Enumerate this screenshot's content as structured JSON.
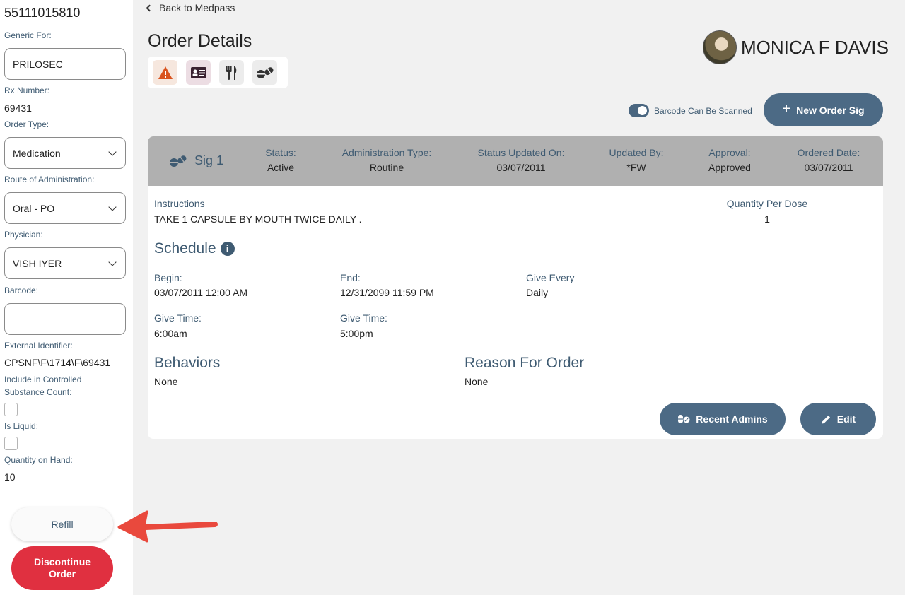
{
  "sidebar": {
    "ndc": "55111015810",
    "generic_label": "Generic For:",
    "generic_value": "PRILOSEC",
    "rx_label": "Rx Number:",
    "rx_value": "69431",
    "order_type_label": "Order Type:",
    "order_type_value": "Medication",
    "route_label": "Route of Administration:",
    "route_value": "Oral - PO",
    "physician_label": "Physician:",
    "physician_value": "VISH IYER",
    "barcode_label": "Barcode:",
    "barcode_value": "",
    "external_label": "External Identifier:",
    "external_value": "CPSNF\\F\\1714\\F\\69431",
    "controlled_label_1": "Include in Controlled",
    "controlled_label_2": "Substance Count:",
    "liquid_label": "Is Liquid:",
    "qoh_label": "Quantity on Hand:",
    "qoh_value": "10",
    "refill_label": "Refill",
    "discontinue_label": "Discontinue Order"
  },
  "header": {
    "back_label": "Back to Medpass",
    "title": "Order Details",
    "patient_name": "MONICA F DAVIS",
    "barcode_toggle_label": "Barcode Can Be Scanned",
    "new_order_sig_label": "New Order Sig"
  },
  "icons": {
    "alert": "warning-icon",
    "id": "id-card-icon",
    "diet": "fork-knife-icon",
    "meds": "pills-icon",
    "alert_color": "#d9531e",
    "accent": "#4c6a85",
    "danger": "#e03040"
  },
  "sig": {
    "name": "Sig 1",
    "status_label": "Status:",
    "status_value": "Active",
    "admin_type_label": "Administration Type:",
    "admin_type_value": "Routine",
    "status_updated_label": "Status Updated On:",
    "status_updated_value": "03/07/2011",
    "updated_by_label": "Updated By:",
    "updated_by_value": "*FW",
    "approval_label": "Approval:",
    "approval_value": "Approved",
    "ordered_label": "Ordered Date:",
    "ordered_value": "03/07/2011"
  },
  "details": {
    "instructions_label": "Instructions",
    "instructions_value": "TAKE 1 CAPSULE BY MOUTH TWICE DAILY .",
    "qpd_label": "Quantity Per Dose",
    "qpd_value": "1",
    "schedule_title": "Schedule",
    "begin_label": "Begin:",
    "begin_value": "03/07/2011 12:00 AM",
    "end_label": "End:",
    "end_value": "12/31/2099 11:59 PM",
    "give_every_label": "Give Every",
    "give_every_value": "Daily",
    "give_time_label_1": "Give Time:",
    "give_time_value_1": "6:00am",
    "give_time_label_2": "Give Time:",
    "give_time_value_2": "5:00pm",
    "behaviors_title": "Behaviors",
    "behaviors_value": "None",
    "reason_title": "Reason For Order",
    "reason_value": "None",
    "recent_admins_label": "Recent Admins",
    "edit_label": "Edit"
  }
}
